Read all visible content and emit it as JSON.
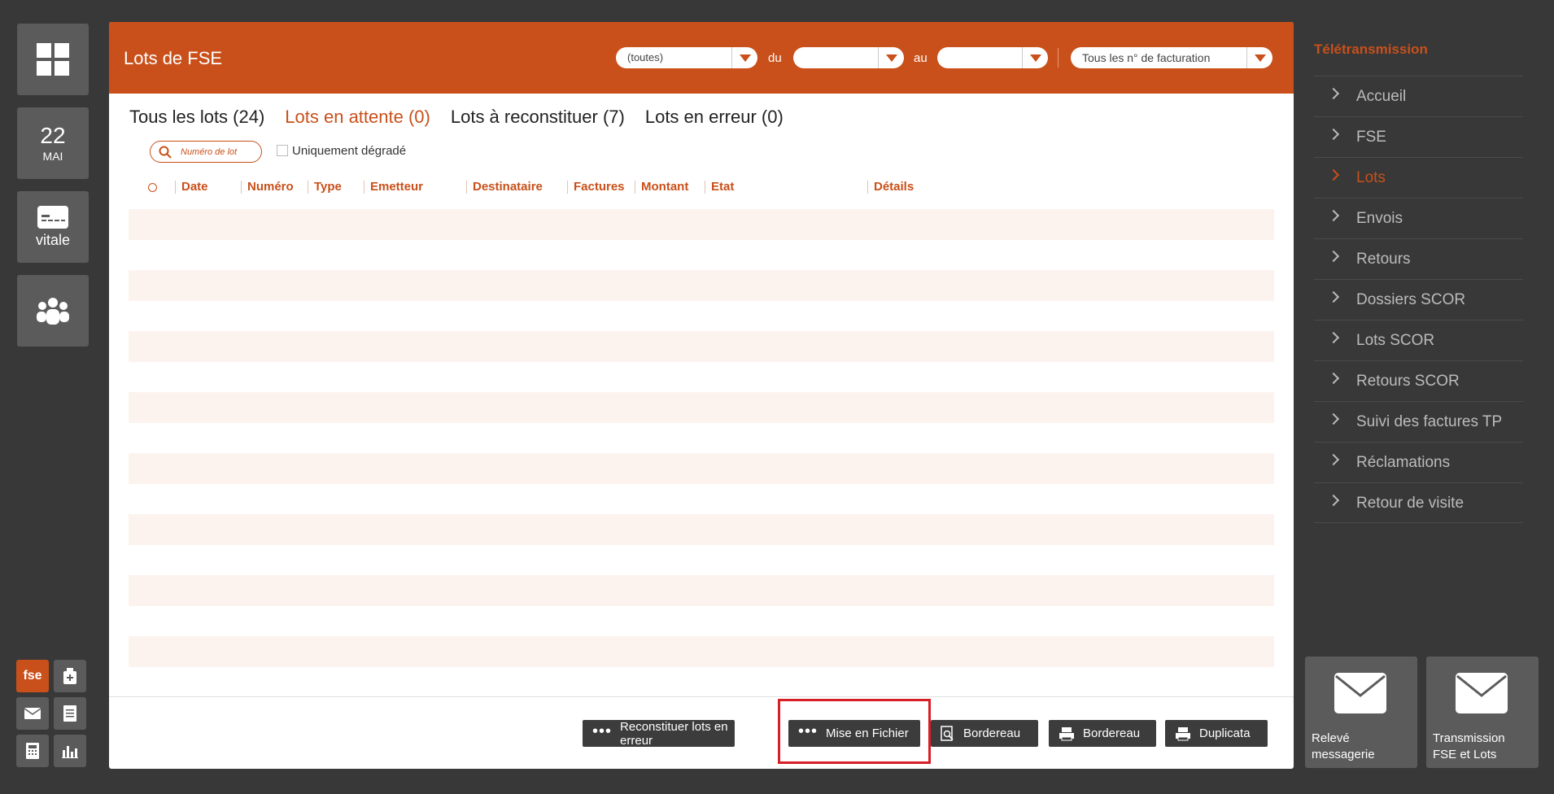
{
  "rail": {
    "date_day": "22",
    "date_month": "MAI",
    "vitale_label": "vitale",
    "mini": [
      "fse"
    ]
  },
  "header": {
    "title": "Lots de FSE",
    "filter1_value": "(toutes)",
    "du_label": "du",
    "du_value": "",
    "au_label": "au",
    "au_value": "",
    "facturation_value": "Tous les n° de facturation"
  },
  "tabs": [
    {
      "label": "Tous les lots (24)"
    },
    {
      "label": "Lots en attente (0)"
    },
    {
      "label": "Lots à reconstituer (7)"
    },
    {
      "label": "Lots en erreur (0)"
    }
  ],
  "active_tab": 1,
  "search": {
    "placeholder": "Numéro de lot"
  },
  "degrade_label": "Uniquement dégradé",
  "columns": [
    "Date",
    "Numéro",
    "Type",
    "Emetteur",
    "Destinataire",
    "Factures",
    "Montant",
    "Etat",
    "Détails"
  ],
  "buttons": {
    "reconstituer": "Reconstituer lots en erreur",
    "mise_en_fichier": "Mise en Fichier",
    "bordereau1": "Bordereau",
    "bordereau2": "Bordereau",
    "duplicata": "Duplicata"
  },
  "nav": {
    "title": "Télétransmission",
    "items": [
      "Accueil",
      "FSE",
      "Lots",
      "Envois",
      "Retours",
      "Dossiers SCOR",
      "Lots SCOR",
      "Retours SCOR",
      "Suivi des factures TP",
      "Réclamations",
      "Retour de visite"
    ],
    "active": "Lots"
  },
  "tiles": {
    "releve_line1": "Relevé",
    "releve_line2": "messagerie",
    "transmission_line1": "Transmission",
    "transmission_line2": "FSE et Lots"
  },
  "colors": {
    "accent": "#c9501a",
    "background": "#383838",
    "tile": "#5b5b5b",
    "highlight": "#d71f27"
  }
}
